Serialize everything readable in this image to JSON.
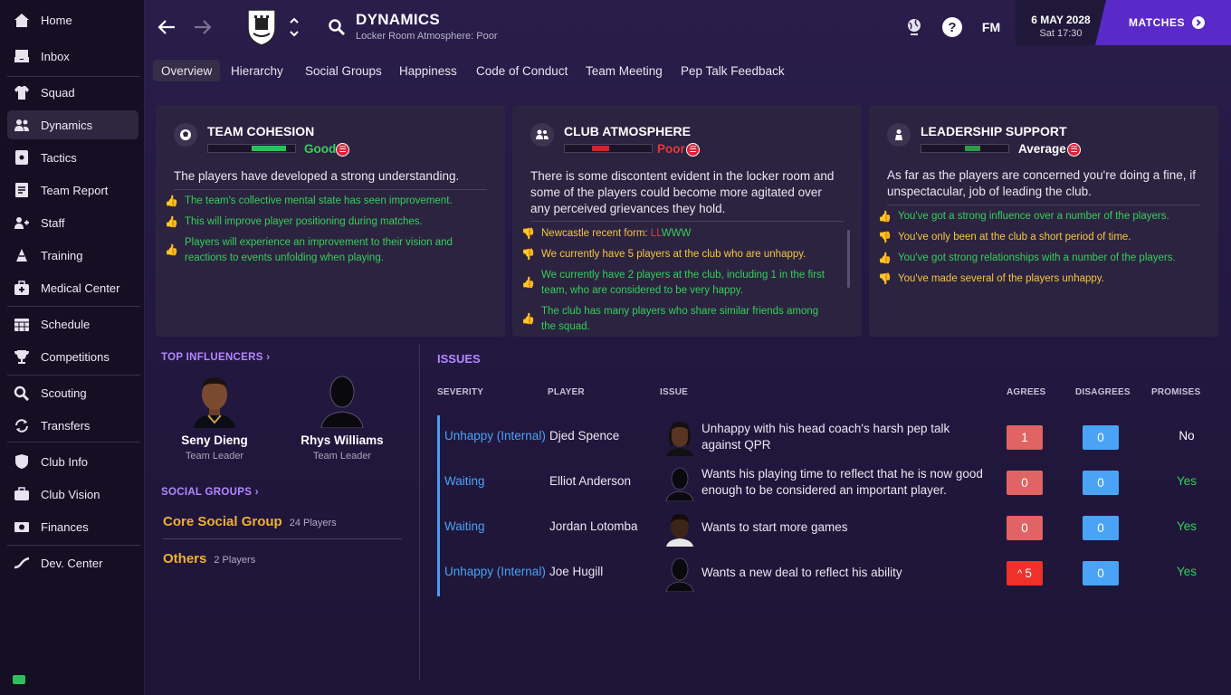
{
  "sidebar": {
    "items": [
      {
        "label": "Home",
        "icon": "home-icon"
      },
      {
        "label": "Inbox",
        "icon": "inbox-icon"
      },
      {
        "label": "Squad",
        "icon": "shirt-icon"
      },
      {
        "label": "Dynamics",
        "icon": "dynamics-icon",
        "active": true
      },
      {
        "label": "Tactics",
        "icon": "tactics-icon"
      },
      {
        "label": "Team Report",
        "icon": "report-icon"
      },
      {
        "label": "Staff",
        "icon": "staff-icon"
      },
      {
        "label": "Training",
        "icon": "training-icon"
      },
      {
        "label": "Medical Center",
        "icon": "medical-icon"
      },
      {
        "label": "Schedule",
        "icon": "calendar-icon"
      },
      {
        "label": "Competitions",
        "icon": "trophy-icon"
      },
      {
        "label": "Scouting",
        "icon": "search-icon"
      },
      {
        "label": "Transfers",
        "icon": "transfers-icon"
      },
      {
        "label": "Club Info",
        "icon": "shield-icon"
      },
      {
        "label": "Club Vision",
        "icon": "briefcase-icon"
      },
      {
        "label": "Finances",
        "icon": "finances-icon"
      },
      {
        "label": "Dev. Center",
        "icon": "dev-center-icon"
      }
    ]
  },
  "header": {
    "title": "DYNAMICS",
    "subtitle": "Locker Room Atmosphere: Poor",
    "fm_label": "FM",
    "date": "6 MAY 2028",
    "time": "Sat 17:30",
    "matches_label": "MATCHES"
  },
  "tabs": [
    "Overview",
    "Hierarchy",
    "Social Groups",
    "Happiness",
    "Code of Conduct",
    "Team Meeting",
    "Pep Talk Feedback"
  ],
  "panels": {
    "cohesion": {
      "title": "TEAM COHESION",
      "rating": "Good",
      "rating_color": "#34d058",
      "bar_color": "#2fbf5a",
      "level": 0.4,
      "description": "The players have developed a strong understanding.",
      "items": [
        {
          "type": "good",
          "text": "The team's collective mental state has seen improvement."
        },
        {
          "type": "good",
          "text": "This will improve player positioning during matches."
        },
        {
          "type": "good",
          "text": "Players will experience an improvement to their vision and reactions to events unfolding when playing."
        }
      ]
    },
    "atmosphere": {
      "title": "CLUB ATMOSPHERE",
      "rating": "Poor",
      "rating_color": "#e53a3a",
      "bar_color": "#c82828",
      "level": 0.2,
      "description": "There is some discontent evident in the locker room and some of the players could become more agitated over any perceived grievances they hold.",
      "items": [
        {
          "type": "warn",
          "text_prefix": "Newcastle recent form: ",
          "form_losses": "LL",
          "form_wins": "WWW"
        },
        {
          "type": "warn",
          "text": "We currently have 5 players at the club who are unhappy."
        },
        {
          "type": "good",
          "text": "We currently have 2 players at the club, including 1 in the first team, who are considered to be very happy."
        },
        {
          "type": "good",
          "text": "The club has many players who share similar friends among the squad."
        }
      ]
    },
    "leadership": {
      "title": "LEADERSHIP SUPPORT",
      "rating": "Average",
      "rating_color": "#ffffff",
      "bar_color": "#2f9a4a",
      "level": 0.18,
      "description": "As far as the players are concerned you're doing a fine, if unspectacular, job of leading the club.",
      "items": [
        {
          "type": "good",
          "text": "You've got a strong influence over a number of the players."
        },
        {
          "type": "warn",
          "text": "You've only been at the club a short period of time."
        },
        {
          "type": "good",
          "text": "You've got strong relationships with a number of the players."
        },
        {
          "type": "warn",
          "text": "You've made several of the players unhappy."
        }
      ]
    }
  },
  "influencers": {
    "heading": "TOP INFLUENCERS",
    "players": [
      {
        "name": "Seny Dieng",
        "role": "Team Leader"
      },
      {
        "name": "Rhys Williams",
        "role": "Team Leader"
      }
    ]
  },
  "social_groups": {
    "heading": "SOCIAL GROUPS",
    "groups": [
      {
        "name": "Core Social Group",
        "count": "24 Players"
      },
      {
        "name": "Others",
        "count": "2 Players"
      }
    ]
  },
  "issues": {
    "heading": "ISSUES",
    "columns": [
      "SEVERITY",
      "PLAYER",
      "ISSUE",
      "AGREES",
      "DISAGREES",
      "PROMISES"
    ],
    "rows": [
      {
        "severity": "Unhappy (Internal)",
        "player": "Djed Spence",
        "issue": "Unhappy with his head coach's harsh pep talk against QPR",
        "agrees": "1",
        "disagrees": "0",
        "promise": "No"
      },
      {
        "severity": "Waiting",
        "player": "Elliot Anderson",
        "issue": "Wants his playing time to reflect that he is now good enough to be considered an important player.",
        "agrees": "0",
        "disagrees": "0",
        "promise": "Yes"
      },
      {
        "severity": "Waiting",
        "player": "Jordan Lotomba",
        "issue": "Wants to start more games",
        "agrees": "0",
        "disagrees": "0",
        "promise": "Yes"
      },
      {
        "severity": "Unhappy (Internal)",
        "player": "Joe Hugill",
        "issue": "Wants a new deal to reflect his ability",
        "agrees": "5",
        "agrees_trend": "^",
        "disagrees": "0",
        "promise": "Yes"
      }
    ]
  }
}
